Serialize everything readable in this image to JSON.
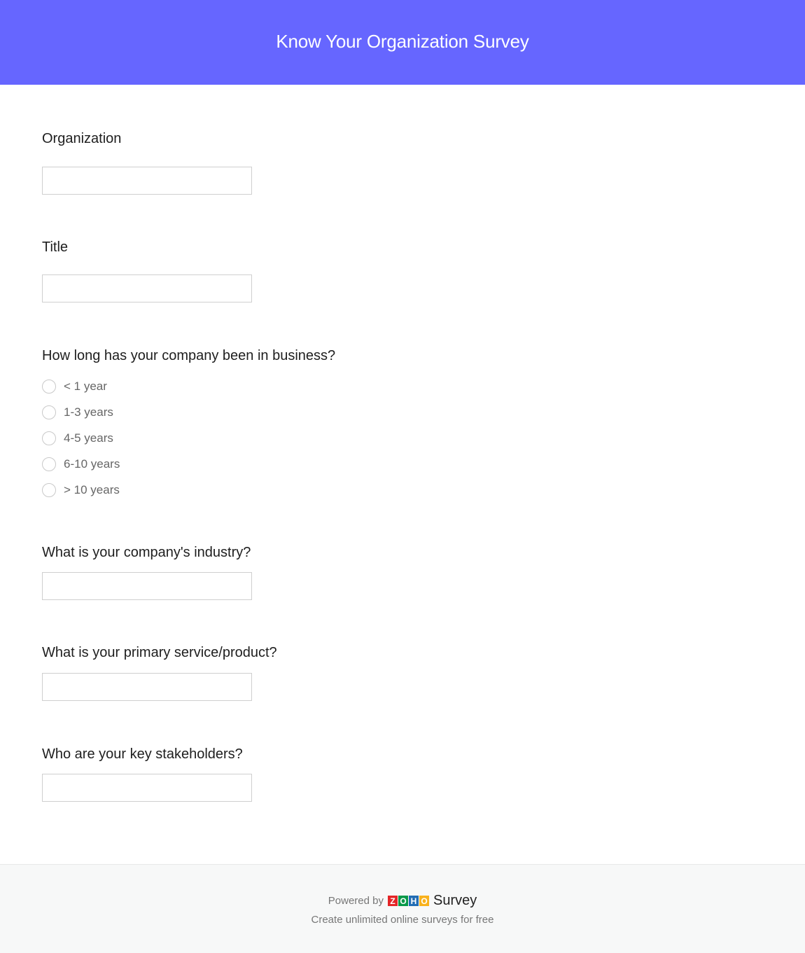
{
  "header": {
    "title": "Know Your Organization Survey",
    "background_color": "#6666ff"
  },
  "questions": {
    "organization": {
      "label": "Organization",
      "value": "",
      "placeholder": ""
    },
    "title": {
      "label": "Title",
      "value": "",
      "placeholder": ""
    },
    "business_duration": {
      "label": "How long has your company been in business?",
      "options": [
        "< 1 year",
        "1-3 years",
        "4-5 years",
        "6-10 years",
        "> 10 years"
      ],
      "selected": null
    },
    "industry": {
      "label": "What is your company's industry?",
      "value": "",
      "placeholder": ""
    },
    "primary_product": {
      "label": "What is your primary service/product?",
      "value": "",
      "placeholder": ""
    },
    "stakeholders": {
      "label": "Who are your key stakeholders?",
      "value": "",
      "placeholder": ""
    }
  },
  "footer": {
    "powered_by": "Powered by",
    "logo_letters": [
      {
        "char": "Z",
        "color": "#e42527"
      },
      {
        "char": "O",
        "color": "#089949"
      },
      {
        "char": "H",
        "color": "#226db4"
      },
      {
        "char": "O",
        "color": "#f9b21d"
      }
    ],
    "product": "Survey",
    "tagline": "Create unlimited online surveys for free"
  }
}
